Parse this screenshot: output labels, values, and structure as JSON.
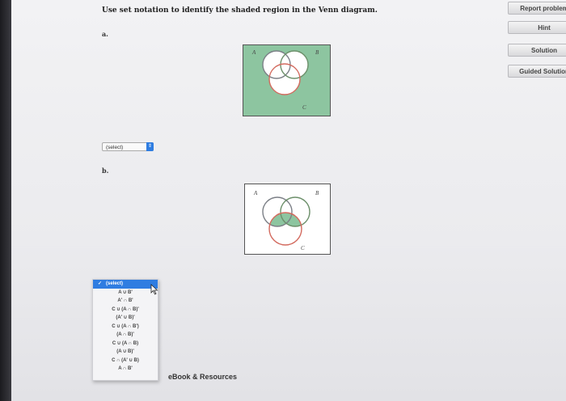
{
  "question": "Use set notation to identify the shaded region in the Venn diagram.",
  "side_buttons": [
    "Report problem",
    "Hint",
    "Solution",
    "Guided Solution"
  ],
  "part_a": {
    "label": "a.",
    "venn_labels": {
      "a": "A",
      "b": "B",
      "c": "C"
    },
    "select_value": "(select)"
  },
  "part_b": {
    "label": "b.",
    "venn_labels": {
      "a": "A",
      "b": "B",
      "c": "C"
    }
  },
  "dropdown": {
    "selected": "(select)",
    "options": [
      "A ∪ B'",
      "A' ∩ B'",
      "C ∪ (A ∩ B)'",
      "(A' ∪ B)'",
      "C ∪ (A ∩ B')",
      "(A ∩ B)'",
      "C ∪ (A ∩ B)",
      "(A ∪ B)'",
      "C ∩ (A' ∪ B)",
      "A ∩ B'"
    ]
  },
  "ebook": "eBook & Resources",
  "colors": {
    "shade": "#8dc5a0",
    "circle_a": "#7b7f86",
    "circle_b": "#6c8f6a",
    "circle_c": "#d36a5e",
    "select_blue": "#2f7de1"
  }
}
